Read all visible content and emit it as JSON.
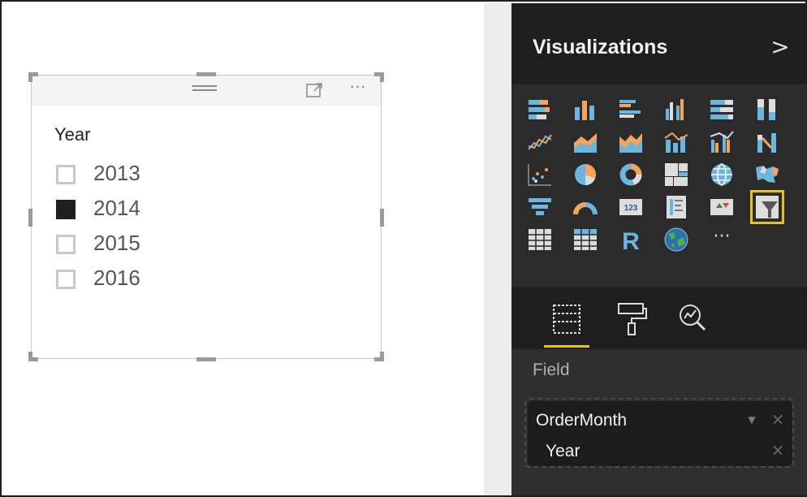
{
  "slicer": {
    "title": "Year",
    "items": [
      {
        "label": "2013",
        "checked": false
      },
      {
        "label": "2014",
        "checked": true
      },
      {
        "label": "2015",
        "checked": false
      },
      {
        "label": "2016",
        "checked": false
      }
    ],
    "more_label": "···"
  },
  "pane": {
    "title": "Visualizations",
    "collapse_glyph": ">",
    "r_visual_label": "R",
    "card_visual_label": "123",
    "more_visuals_label": "···",
    "tabs": [
      "fields-tab",
      "format-tab",
      "analytics-tab"
    ],
    "field_well": {
      "label": "Field",
      "field_name": "OrderMonth",
      "hierarchy_level": "Year",
      "dropdown_glyph": "▼",
      "remove_glyph": "×"
    }
  },
  "colors": {
    "accent": "#e8c31c",
    "blue": "#6cb5de",
    "orange": "#f5a45a",
    "pane_bg": "#2b2b2b"
  }
}
